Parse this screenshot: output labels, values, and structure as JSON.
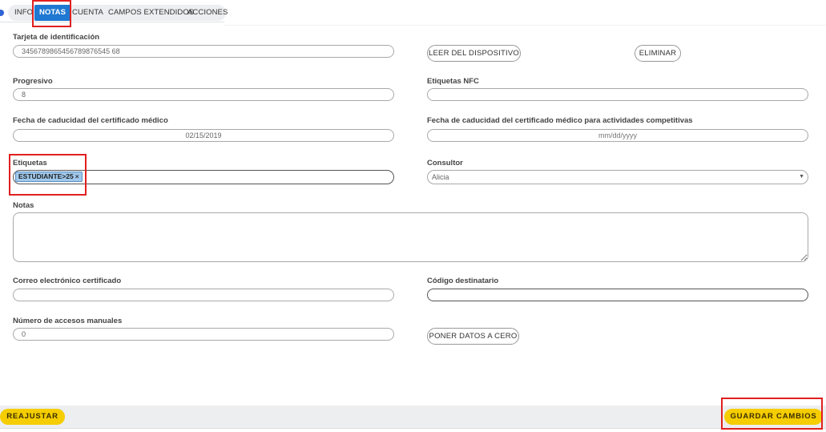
{
  "tabs": [
    "INFO",
    "NOTAS",
    "CUENTA",
    "CAMPOS EXTENDIDOS",
    "ACCIONES"
  ],
  "active_tab": "NOTAS",
  "form": {
    "id_card_label": "Tarjeta de identificación",
    "id_card_value": "3456789865456789876545 68",
    "read_device_label": "LEER DEL DISPOSITIVO",
    "delete_label": "ELIMINAR",
    "progressive_label": "Progresivo",
    "progressive_value": "8",
    "nfc_label": "Etiquetas NFC",
    "nfc_value": "",
    "medcert_label": "Fecha de caducidad del certificado médico",
    "medcert_value": "02/15/2019",
    "medcert_comp_label": "Fecha de caducidad del certificado médico para actividades competitivas",
    "medcert_comp_placeholder": "mm/dd/yyyy",
    "tags_label": "Etiquetas",
    "tag_value": "ESTUDIANTE>25",
    "tag_remove": "×",
    "consultant_label": "Consultor",
    "consultant_value": "Alicia",
    "notes_label": "Notas",
    "notes_value": "",
    "email_label": "Correo electrónico certificado",
    "email_value": "",
    "recipient_label": "Código destinatario",
    "recipient_value": "",
    "manual_access_label": "Número de accesos manuales",
    "manual_access_value": "0",
    "reset_data_label": "PONER DATOS A CERO"
  },
  "footer": {
    "reset_label": "REAJUSTAR",
    "save_label": "GUARDAR CAMBIOS"
  },
  "colors": {
    "active_tab": "#1f78d1",
    "footer_buttons": "#f5cd00",
    "highlight_box": "#e02020"
  }
}
